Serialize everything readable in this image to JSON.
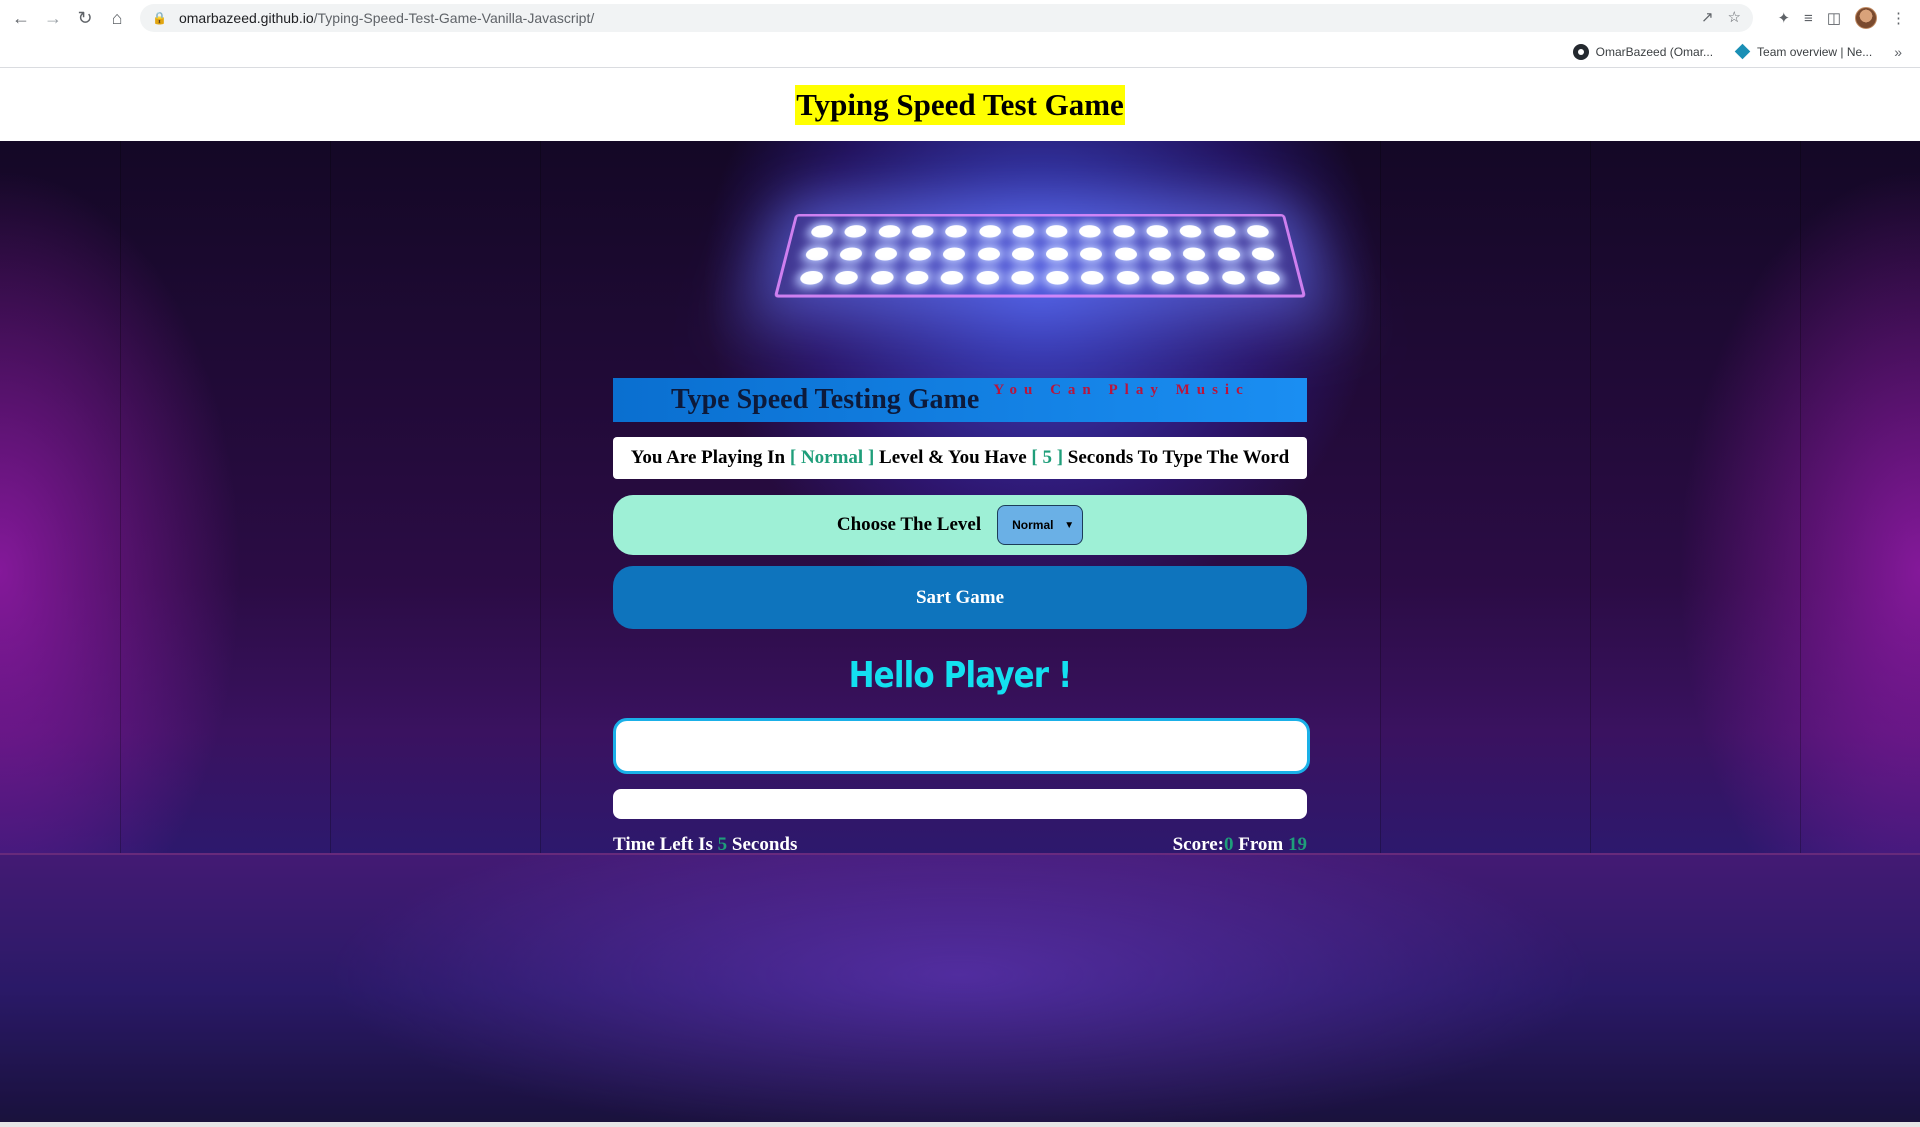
{
  "browser": {
    "url_host": "omarbazeed.github.io",
    "url_path": "/Typing-Speed-Test-Game-Vanilla-Javascript/",
    "bookmarks": [
      {
        "label": "OmarBazeed (Omar...",
        "icon": "github-icon"
      },
      {
        "label": "Team overview | Ne...",
        "icon": "diamond-icon"
      }
    ],
    "more_bookmarks": "»"
  },
  "page": {
    "header_title": "Typing Speed Test Game"
  },
  "game": {
    "title": "Type Speed Testing Game",
    "music_hint": "You Can Play Music",
    "message": {
      "prefix": "You Are Playing In ",
      "level": "[ Normal ]",
      "middle": " Level & You Have ",
      "seconds": "[ 5 ]",
      "suffix": " Seconds To Type The Word"
    },
    "choose_level_label": "Choose The Level",
    "selected_level": "Normal",
    "start_label": "Sart Game",
    "greeting": "Hello Player !",
    "input_value": "",
    "time_left_prefix": "Time Left Is ",
    "time_left_value": "5",
    "time_left_suffix": " Seconds",
    "score_prefix": "Score:",
    "score_value": "0",
    "score_from": " From ",
    "score_total": "19"
  },
  "colors": {
    "accent_green": "#1f9e7a",
    "header_highlight": "#ffff00",
    "level_box": "#9ef0d6",
    "start_button": "#0e74bd",
    "greeting": "#13e0f0"
  }
}
